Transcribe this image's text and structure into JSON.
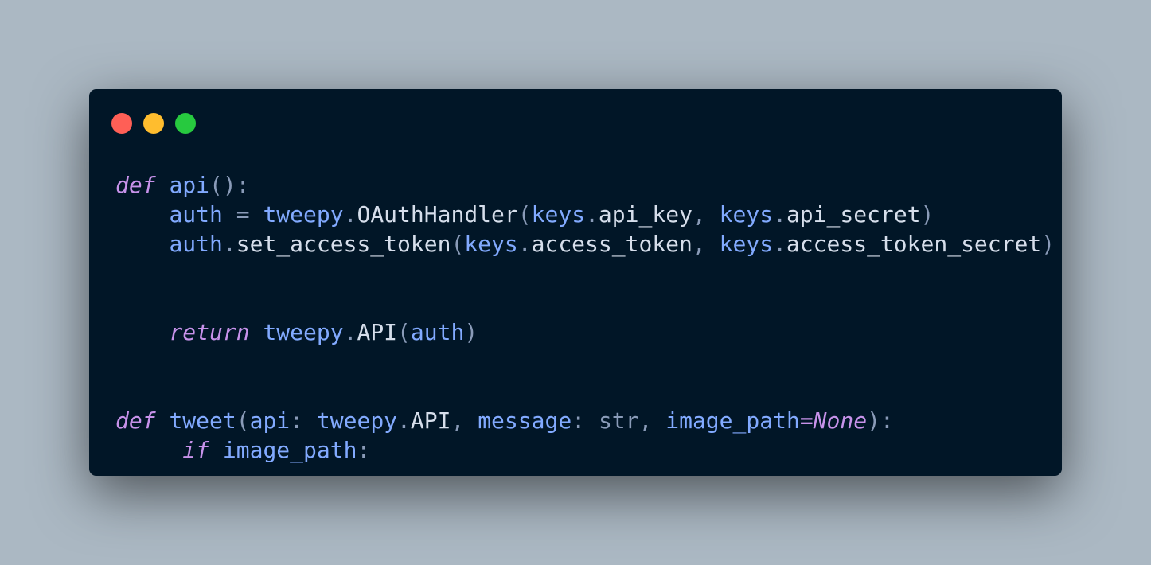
{
  "window": {
    "controls": [
      {
        "name": "close-button",
        "color": "#ff5f56"
      },
      {
        "name": "minimize-button",
        "color": "#ffbd2e"
      },
      {
        "name": "maximize-button",
        "color": "#27c93f"
      }
    ]
  },
  "colors": {
    "background": "#abb8c3",
    "editor": "#011627",
    "keyword": "#c792ea",
    "identifier": "#82aaff",
    "default": "#d6deeb",
    "punctuation": "#8a9bb8"
  },
  "code": {
    "language": "python",
    "lines": [
      [
        {
          "t": "def",
          "c": "keyword"
        },
        {
          "t": " ",
          "c": "default"
        },
        {
          "t": "api",
          "c": "identifier"
        },
        {
          "t": "():",
          "c": "punctuation"
        }
      ],
      [
        {
          "t": "    ",
          "c": "default"
        },
        {
          "t": "auth",
          "c": "identifier"
        },
        {
          "t": " = ",
          "c": "punctuation"
        },
        {
          "t": "tweepy",
          "c": "identifier"
        },
        {
          "t": ".",
          "c": "punctuation"
        },
        {
          "t": "OAuthHandler",
          "c": "default"
        },
        {
          "t": "(",
          "c": "punctuation"
        },
        {
          "t": "keys",
          "c": "identifier"
        },
        {
          "t": ".",
          "c": "punctuation"
        },
        {
          "t": "api_key",
          "c": "default"
        },
        {
          "t": ", ",
          "c": "punctuation"
        },
        {
          "t": "keys",
          "c": "identifier"
        },
        {
          "t": ".",
          "c": "punctuation"
        },
        {
          "t": "api_secret",
          "c": "default"
        },
        {
          "t": ")",
          "c": "punctuation"
        }
      ],
      [
        {
          "t": "    ",
          "c": "default"
        },
        {
          "t": "auth",
          "c": "identifier"
        },
        {
          "t": ".",
          "c": "punctuation"
        },
        {
          "t": "set_access_token",
          "c": "default"
        },
        {
          "t": "(",
          "c": "punctuation"
        },
        {
          "t": "keys",
          "c": "identifier"
        },
        {
          "t": ".",
          "c": "punctuation"
        },
        {
          "t": "access_token",
          "c": "default"
        },
        {
          "t": ", ",
          "c": "punctuation"
        },
        {
          "t": "keys",
          "c": "identifier"
        },
        {
          "t": ".",
          "c": "punctuation"
        },
        {
          "t": "access_token_secret",
          "c": "default"
        },
        {
          "t": ")",
          "c": "punctuation"
        }
      ],
      [],
      [],
      [
        {
          "t": "    ",
          "c": "default"
        },
        {
          "t": "return",
          "c": "keyword"
        },
        {
          "t": " ",
          "c": "default"
        },
        {
          "t": "tweepy",
          "c": "identifier"
        },
        {
          "t": ".",
          "c": "punctuation"
        },
        {
          "t": "API",
          "c": "default"
        },
        {
          "t": "(",
          "c": "punctuation"
        },
        {
          "t": "auth",
          "c": "identifier"
        },
        {
          "t": ")",
          "c": "punctuation"
        }
      ],
      [],
      [],
      [
        {
          "t": "def",
          "c": "keyword"
        },
        {
          "t": " ",
          "c": "default"
        },
        {
          "t": "tweet",
          "c": "identifier"
        },
        {
          "t": "(",
          "c": "punctuation"
        },
        {
          "t": "api",
          "c": "identifier"
        },
        {
          "t": ": ",
          "c": "punctuation"
        },
        {
          "t": "tweepy",
          "c": "identifier"
        },
        {
          "t": ".",
          "c": "punctuation"
        },
        {
          "t": "API",
          "c": "default"
        },
        {
          "t": ", ",
          "c": "punctuation"
        },
        {
          "t": "message",
          "c": "identifier"
        },
        {
          "t": ": ",
          "c": "punctuation"
        },
        {
          "t": "str",
          "c": "punctuation"
        },
        {
          "t": ", ",
          "c": "punctuation"
        },
        {
          "t": "image_path",
          "c": "identifier"
        },
        {
          "t": "=",
          "c": "keyword"
        },
        {
          "t": "None",
          "c": "keyword"
        },
        {
          "t": "):",
          "c": "punctuation"
        }
      ],
      [
        {
          "t": "     ",
          "c": "default"
        },
        {
          "t": "if",
          "c": "keyword"
        },
        {
          "t": " ",
          "c": "default"
        },
        {
          "t": "image_path",
          "c": "identifier"
        },
        {
          "t": ":",
          "c": "punctuation"
        }
      ]
    ]
  }
}
